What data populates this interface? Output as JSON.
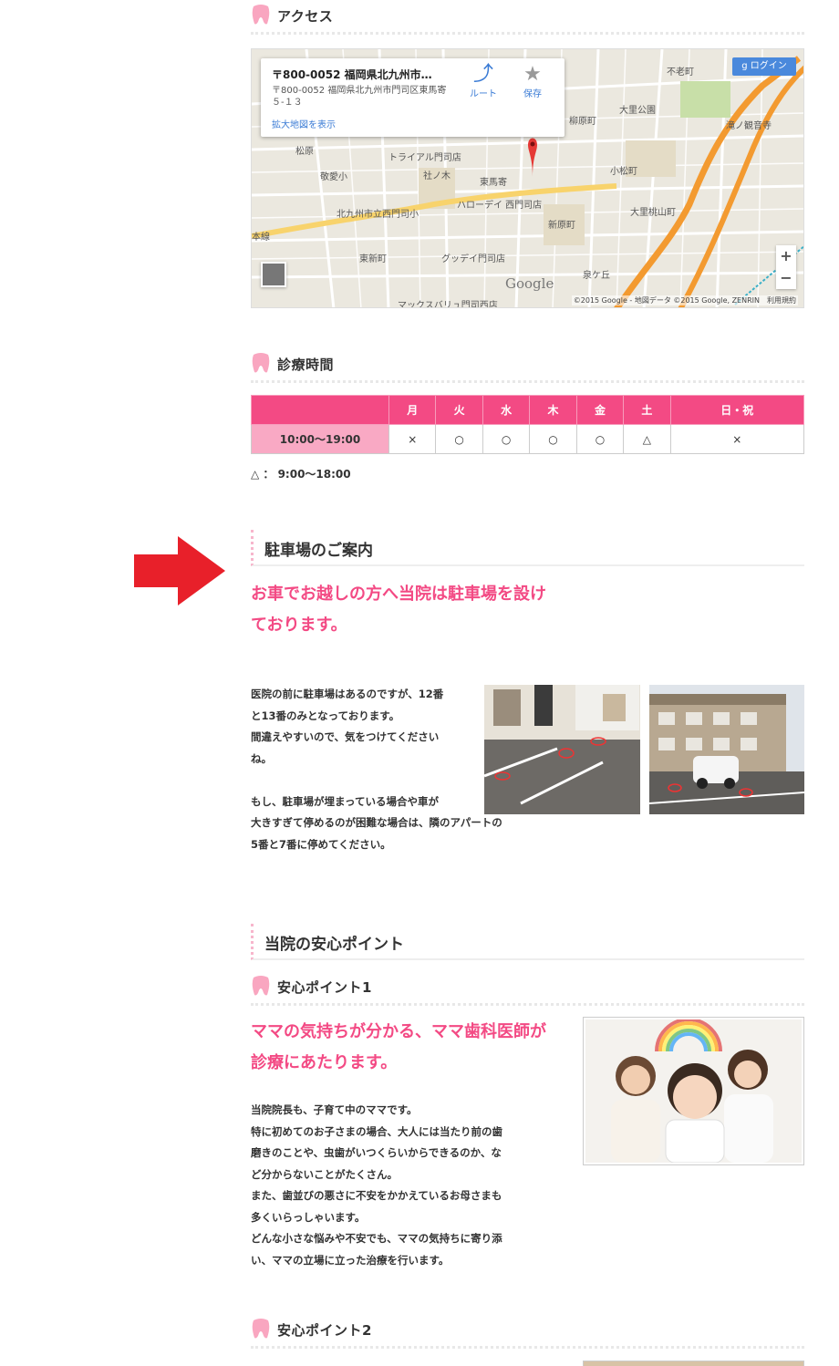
{
  "access": {
    "heading": "アクセス"
  },
  "map": {
    "info_title": "〒800-0052 福岡県北九州市…",
    "info_address": "〒800-0052 福岡県北九州市門司区東馬寄５-１３",
    "enlarge_link": "拡大地図を表示",
    "route_label": "ルート",
    "save_label": "保存",
    "login_label": "ログイン",
    "zoom_in": "+",
    "zoom_out": "−",
    "logo": "Google",
    "copyright": "©2015 Google - 地図データ ©2015 Google, ZENRIN　利用規約",
    "labels": [
      "不老町",
      "大里公園",
      "滝ノ観音寺",
      "柳原町",
      "小松町",
      "松原",
      "トライアル門司店",
      "敬愛小",
      "社ノ木",
      "東馬寄",
      "ハローデイ 西門司店",
      "北九州市立西門司小",
      "大里桃山町",
      "新原町",
      "本線",
      "東新町",
      "グッデイ門司店",
      "泉ケ丘",
      "マックスバリュ門司西店"
    ]
  },
  "hours": {
    "heading": "診療時間",
    "days": [
      "月",
      "火",
      "水",
      "木",
      "金",
      "土",
      "日・祝"
    ],
    "time": "10:00〜19:00",
    "marks": [
      "×",
      "○",
      "○",
      "○",
      "○",
      "△",
      "×"
    ],
    "note": "△ ： 9:00〜18:00"
  },
  "parking": {
    "heading": "駐車場のご案内",
    "lead": "お車でお越しの方へ当院は駐車場を設けております。",
    "text_lines": [
      "医院の前に駐車場はあるのですが、12番",
      "と13番のみとなっております。",
      "間違えやすいので、気をつけてください",
      "ね。",
      "",
      "もし、駐車場が埋まっている場合や車が",
      "大きすぎて停めるのが困難な場合は、隣のアパートの",
      "5番と7番に停めてください。"
    ]
  },
  "points": {
    "heading": "当院の安心ポイント",
    "point1": {
      "heading": "安心ポイント1",
      "lead": "ママの気持ちが分かる、ママ歯科医師が診療にあたります。",
      "text_lines": [
        "当院院長も、子育て中のママです。",
        "特に初めてのお子さまの場合、大人には当たり前の歯",
        "磨きのことや、虫歯がいつくらいからできるのか、な",
        "ど分からないことがたくさん。",
        "また、歯並びの悪さに不安をかかえているお母さまも",
        "多くいらっしゃいます。",
        "どんな小さな悩みや不安でも、ママの気持ちに寄り添",
        "い、ママの立場に立った治療を行います。"
      ]
    },
    "point2": {
      "heading": "安心ポイント2"
    }
  },
  "colors": {
    "accent": "#f34a84",
    "table_time_bg": "#f9a9c4",
    "arrow": "#e8202a"
  }
}
